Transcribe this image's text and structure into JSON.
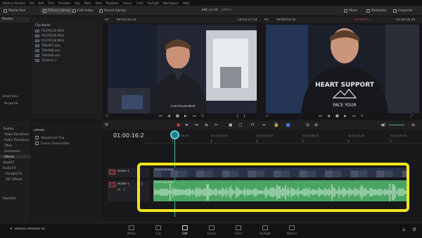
{
  "menu": [
    "DaVinci Resolve",
    "File",
    "Edit",
    "Trim",
    "Timeline",
    "Clip",
    "Mark",
    "View",
    "Playback",
    "Fusion",
    "Color",
    "Fairlight",
    "Workspace",
    "Help"
  ],
  "toolbar": {
    "media_pool": "Media Pool",
    "effects_library": "Effects Library",
    "edit_index": "Edit Index",
    "sound_library": "Sound Library",
    "project_title": "Tutt_11-24",
    "edited": "Edited",
    "mixer": "Mixer",
    "metadata": "Metadata",
    "inspector": "Inspector"
  },
  "media_pool": {
    "master": "Master",
    "smart_bins": "Smart Bins",
    "keywords": "Keywords",
    "clips_header": "Clip Name",
    "clips": [
      "P1070120.MOV",
      "P1070126.MOV",
      "P1070128.MOV",
      "TRK-907.wav",
      "TRK-908.wav",
      "TRK-909.wav",
      "Timeline 1"
    ]
  },
  "effects": {
    "toolbox": "Toolbox",
    "items": [
      "Video Transitions",
      "Audio Transitions",
      "Titles",
      "Generators",
      "Effects",
      "OpenFX",
      "Audio FX",
      "Fairlight FX",
      "VST Effects"
    ],
    "favorites": "Favorites",
    "panel_title": "Effects",
    "panel_items": [
      "Adjustment Clip",
      "Fusion Composition"
    ]
  },
  "source_viewer": {
    "zoom": "Fit",
    "timecode": "00:05:54:10",
    "clip_name": "P1070126.MOV",
    "duration": "14:53:37:14"
  },
  "timeline_viewer": {
    "zoom": "Fit",
    "timecode": "00:00:54:10",
    "timeline_name": "Timeline 1",
    "current_tc": "01:00:16:26"
  },
  "timeline": {
    "timecode": "01:00:16:26",
    "ruler": [
      "01:00:00:00",
      "01:00:16:00",
      "01:00:32:00",
      "01:00:48:00",
      "01:01:04:00",
      "01:01:20:00"
    ],
    "video_track": "Video 1",
    "video_id": "V1",
    "audio_track": "Audio 1",
    "audio_id": "A1",
    "audio_level": "2.0",
    "video_clip": "P1070126.MOV",
    "audio_clip": "P1070126.MOV",
    "highlight_color": "#f2e51c",
    "playhead_color": "#3fb4b4",
    "audio_color": "#4aa464",
    "video_color": "#3c6fb0"
  },
  "app_name": "DaVinci Resolve 16",
  "pages": [
    "Media",
    "Cut",
    "Edit",
    "Fusion",
    "Color",
    "Fairlight",
    "Deliver"
  ],
  "active_page": "Edit"
}
